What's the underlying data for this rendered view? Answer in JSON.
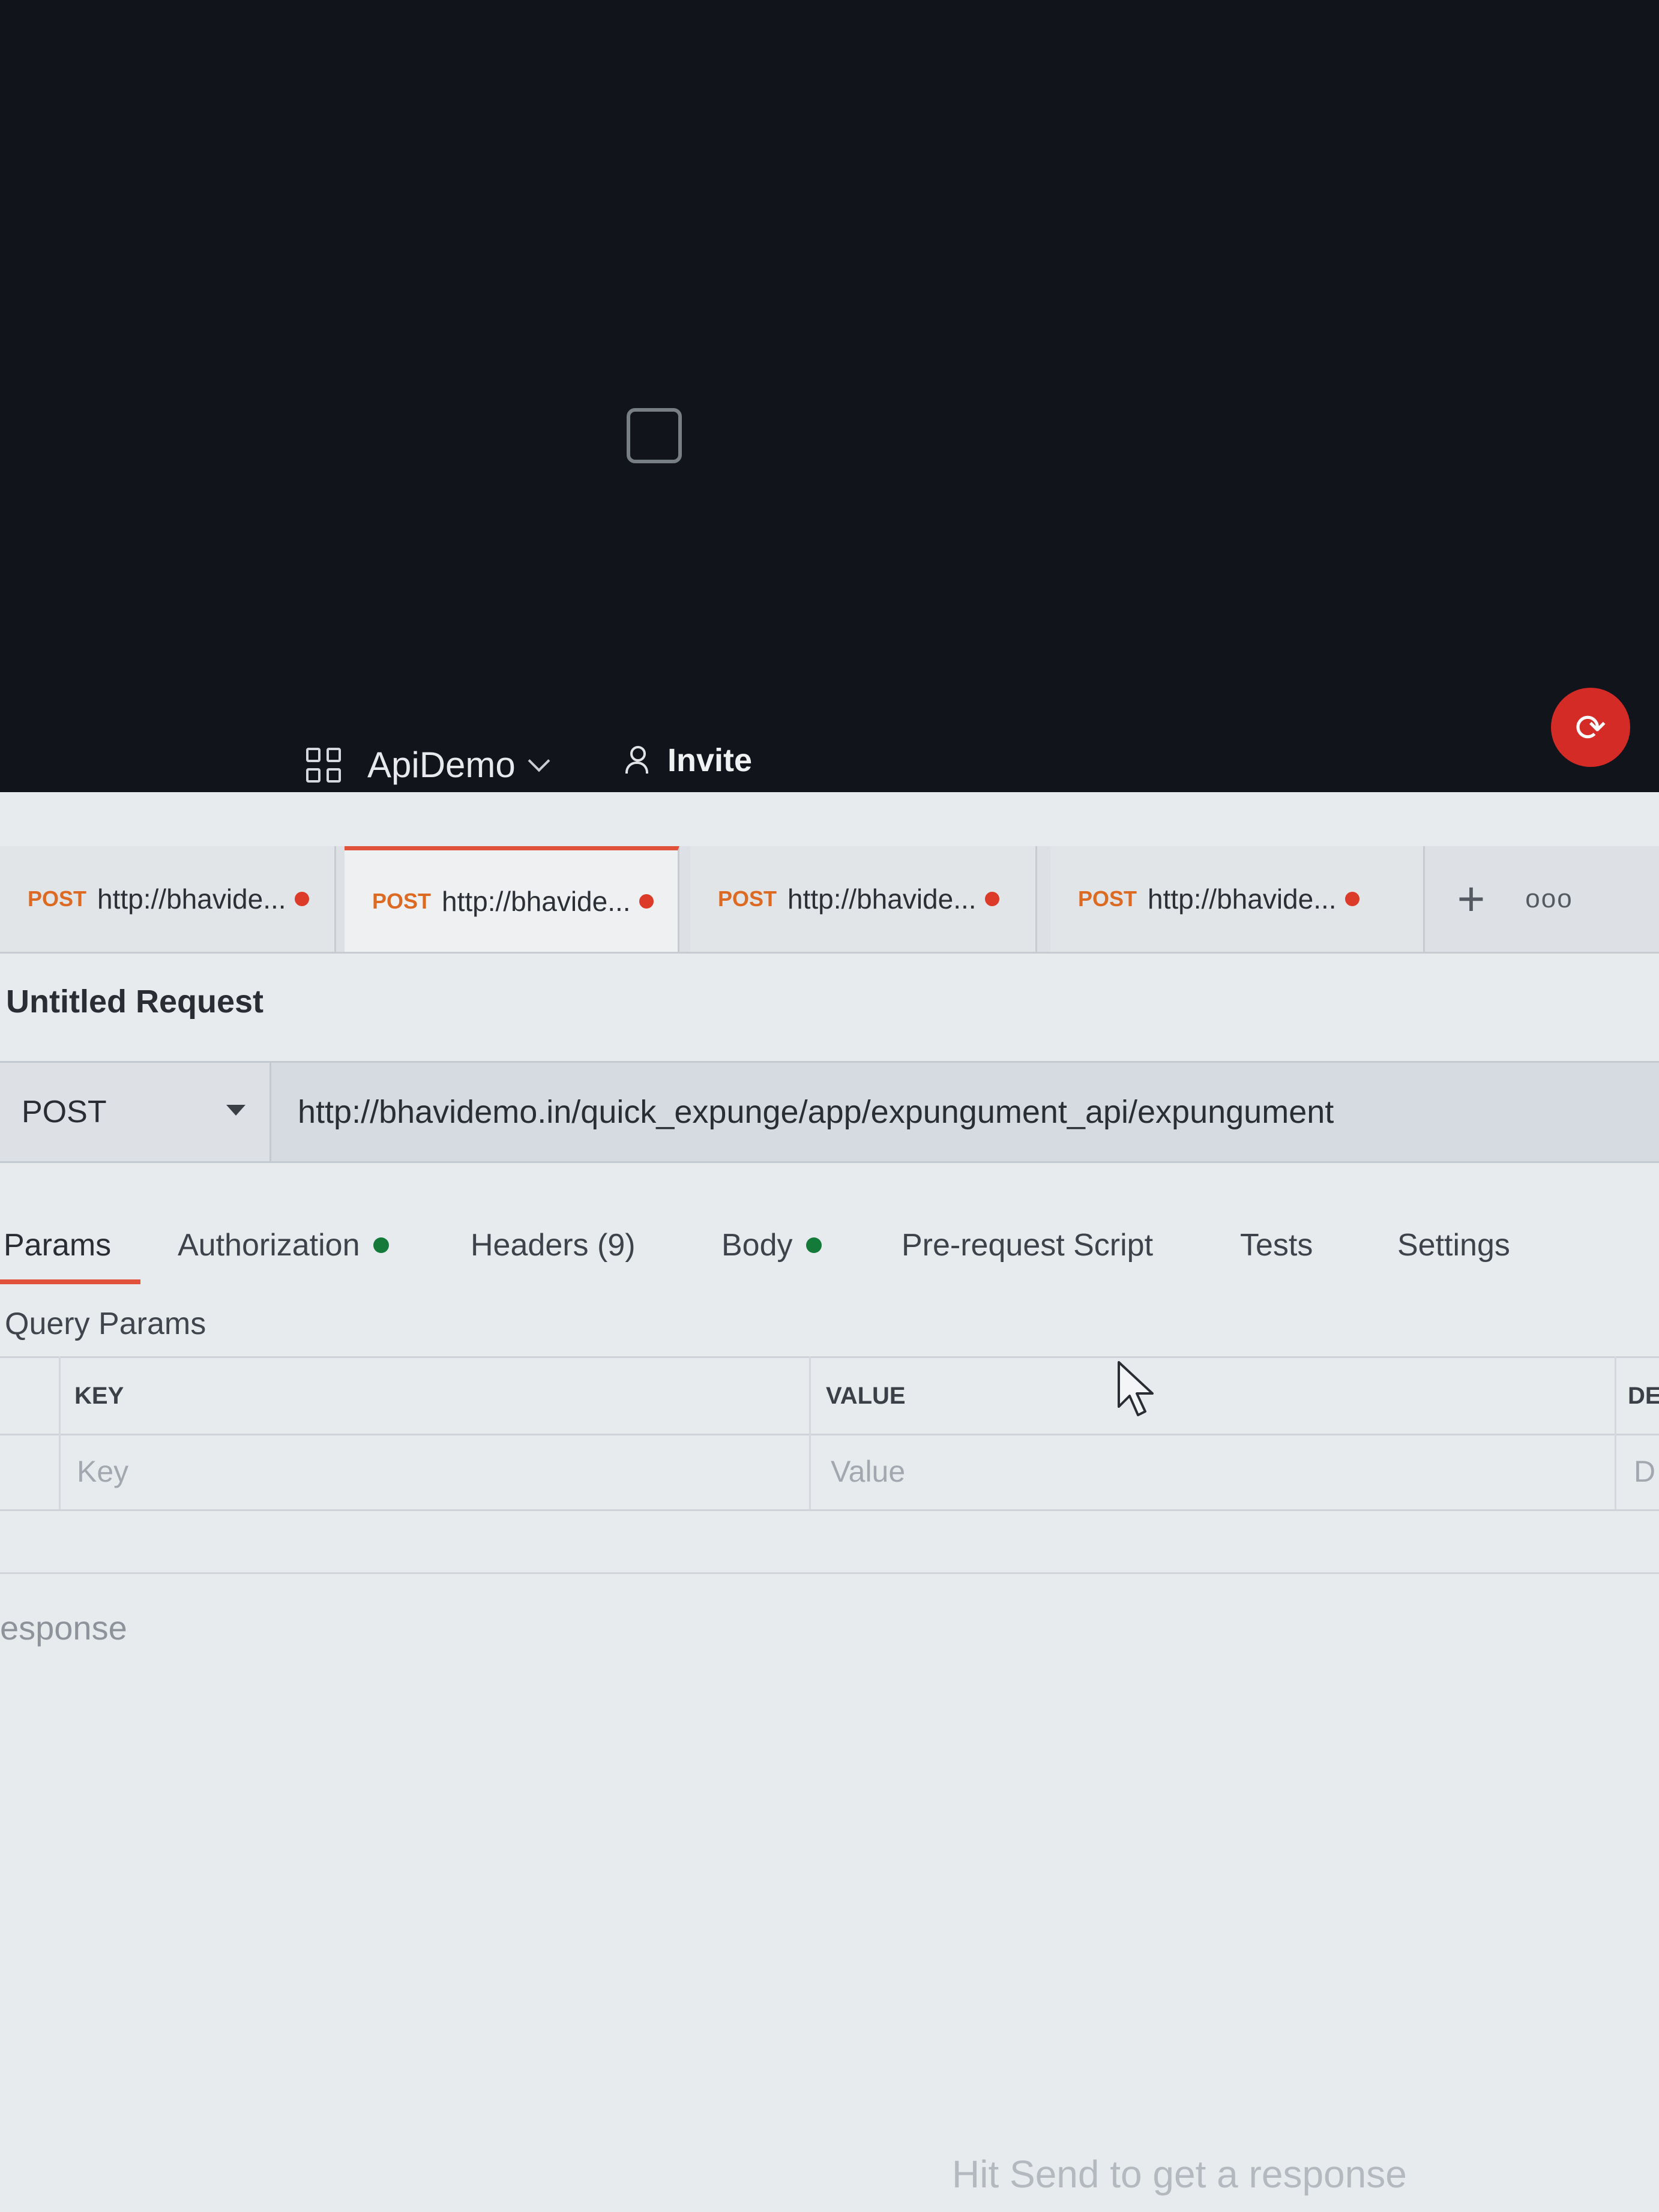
{
  "workspace": {
    "name": "ApiDemo",
    "invite_label": "Invite"
  },
  "tabs": [
    {
      "method": "POST",
      "label": "http://bhavide...",
      "active": false
    },
    {
      "method": "POST",
      "label": "http://bhavide...",
      "active": true
    },
    {
      "method": "POST",
      "label": "http://bhavide...",
      "active": false
    },
    {
      "method": "POST",
      "label": "http://bhavide...",
      "active": false
    }
  ],
  "tab_actions": {
    "new_tab": "+",
    "more": "ooo"
  },
  "request": {
    "title": "Untitled Request",
    "method": "POST",
    "url": "http://bhavidemo.in/quick_expunge/app/expungument_api/expungument"
  },
  "request_tabs": [
    {
      "label": "Params",
      "active": true,
      "dot": false
    },
    {
      "label": "Authorization",
      "active": false,
      "dot": true
    },
    {
      "label": "Headers (9)",
      "active": false,
      "dot": false
    },
    {
      "label": "Body",
      "active": false,
      "dot": true
    },
    {
      "label": "Pre-request Script",
      "active": false,
      "dot": false
    },
    {
      "label": "Tests",
      "active": false,
      "dot": false
    },
    {
      "label": "Settings",
      "active": false,
      "dot": false
    }
  ],
  "params": {
    "section_title": "Query Params",
    "columns": [
      "KEY",
      "VALUE",
      "DE"
    ],
    "placeholders": [
      "Key",
      "Value",
      "D"
    ]
  },
  "response": {
    "label": "esponse",
    "empty_hint": "Hit Send to get a response"
  },
  "colors": {
    "accent": "#e0533a",
    "method_post": "#dd6a22",
    "unsaved_dot": "#dc3b29",
    "status_dot": "#137a3a",
    "sync_button": "#d42b26"
  },
  "icons": {
    "workspace": "grid-icon",
    "invite": "user-plus-icon",
    "sync": "sync-icon",
    "method_dropdown": "caret-down-icon"
  }
}
